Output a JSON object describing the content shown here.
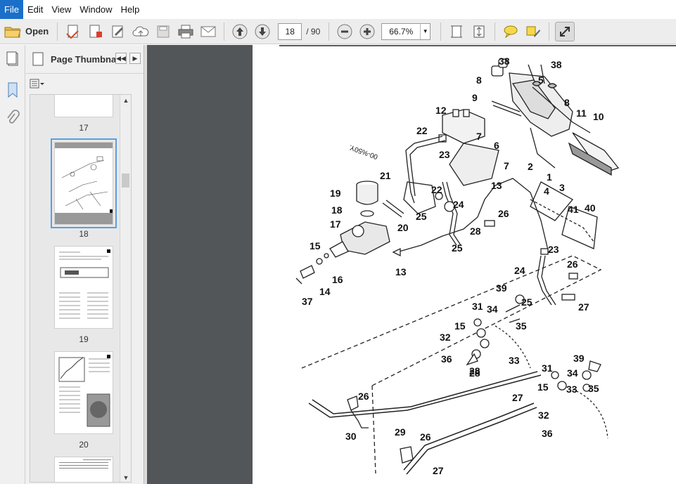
{
  "menu": {
    "items": [
      "File",
      "Edit",
      "View",
      "Window",
      "Help"
    ]
  },
  "toolbar": {
    "open_label": "Open",
    "page_current": "18",
    "page_total": "/ 90",
    "zoom": "66.7%"
  },
  "thumbnails": {
    "title": "Page Thumbnails",
    "pages": [
      {
        "label": "17"
      },
      {
        "label": "18"
      },
      {
        "label": "19"
      },
      {
        "label": "20"
      }
    ]
  },
  "diagram": {
    "stamp": "00-%50Y.",
    "callouts": [
      "38",
      "38",
      "8",
      "5",
      "9",
      "8",
      "12",
      "11",
      "10",
      "22",
      "7",
      "6",
      "23",
      "7",
      "2",
      "1",
      "21",
      "22",
      "13",
      "4",
      "3",
      "19",
      "24",
      "41",
      "40",
      "18",
      "26",
      "17",
      "20",
      "25",
      "28",
      "15",
      "25",
      "23",
      "13",
      "16",
      "24",
      "26",
      "14",
      "39",
      "25",
      "27",
      "37",
      "31",
      "34",
      "15",
      "35",
      "32",
      "33",
      "36",
      "28",
      "39",
      "31",
      "34",
      "28",
      "26",
      "15",
      "33",
      "35",
      "27",
      "32",
      "36",
      "30",
      "29",
      "26",
      "27"
    ]
  },
  "colors": {
    "menu_active": "#1a6fc9",
    "doc_background": "#525659",
    "toolbar": "#ededed"
  }
}
